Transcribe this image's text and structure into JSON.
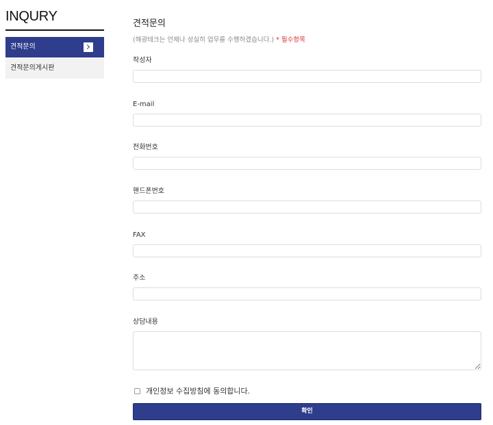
{
  "sidebar": {
    "title": "INQURY",
    "items": [
      {
        "label": "견적문의",
        "active": true
      },
      {
        "label": "견적문의게시판",
        "active": false
      }
    ]
  },
  "main": {
    "heading": "견적문의",
    "subtitle": "(해광테크는 언제나 성실히 업무를 수행하겠습니다.)",
    "required_note": "* 필수항목",
    "fields": [
      {
        "label": "작성자",
        "value": ""
      },
      {
        "label": "E-mail",
        "value": ""
      },
      {
        "label": "전화번호",
        "value": ""
      },
      {
        "label": "핸드폰번호",
        "value": ""
      },
      {
        "label": "FAX",
        "value": ""
      },
      {
        "label": "주소",
        "value": ""
      },
      {
        "label": "상담내용",
        "value": ""
      }
    ],
    "agree_label": "개인정보 수집방침에 동의합니다.",
    "submit_label": "확인"
  },
  "colors": {
    "accent": "#2e3d8c",
    "required": "#d9302c",
    "side_inactive_bg": "#f2f2f2"
  },
  "icons": {
    "active_arrow": "chevron-right-icon"
  }
}
